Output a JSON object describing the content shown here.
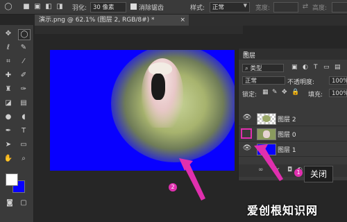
{
  "options_bar": {
    "feather_label": "羽化:",
    "feather_value": "30 像素",
    "antialias_label": "消除锯齿",
    "style_label": "样式:",
    "style_value": "正常",
    "width_label": "宽度:",
    "height_label": "高度:"
  },
  "document_tab": {
    "title": "演示.png @ 62.1% (图层 2, RGB/8#) *",
    "close": "×"
  },
  "layers_panel": {
    "title": "图层",
    "filter_kind": "类型",
    "blend_mode": "正常",
    "opacity_label": "不透明度:",
    "opacity_value": "100%",
    "lock_label": "锁定:",
    "fill_label": "填充:",
    "fill_value": "100%",
    "layers": [
      {
        "name": "图层 2",
        "visible": true,
        "selected": false
      },
      {
        "name": "图层 0",
        "visible": false,
        "selected": false
      },
      {
        "name": "图层 1",
        "visible": true,
        "selected": false
      }
    ],
    "footer_icons": [
      "link-icon",
      "fx-icon",
      "mask-icon",
      "adjustment-icon",
      "folder-icon",
      "new-layer-icon",
      "trash-icon"
    ]
  },
  "annotations": {
    "marker_1": "1",
    "marker_2": "2",
    "tooltip": "关闭",
    "arrow_color": "#e02fae"
  },
  "colors": {
    "canvas_blue": "#0800ff",
    "foreground_color": "#ffffff",
    "background_color": "#0800ff"
  },
  "watermark": "爱创根知识网"
}
